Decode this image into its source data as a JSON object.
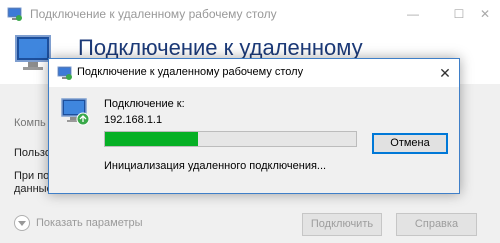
{
  "main": {
    "title": "Подключение к удаленному рабочему столу",
    "header_title": "Подключение к удаленному",
    "labels": [
      "Компь",
      "Пользо",
      "При по",
      "данные"
    ],
    "show_options": "Показать параметры",
    "connect_button": "Подключить",
    "help_button": "Справка",
    "minimize_symbol": "—",
    "maximize_symbol": "☐",
    "close_symbol": "✕"
  },
  "dialog": {
    "title": "Подключение к удаленному рабочему столу",
    "close_symbol": "✕",
    "connecting_label": "Подключение к:",
    "host": "192.168.1.1",
    "progress_percent": 37,
    "cancel_button": "Отмена",
    "status": "Инициализация удаленного подключения..."
  },
  "colors": {
    "accent": "#0078d7",
    "progress_fill": "#06b025",
    "header_title": "#1c3a78"
  },
  "icons": [
    "remote-desktop-icon",
    "close-icon",
    "minimize-icon",
    "maximize-icon",
    "chevron-down-icon"
  ]
}
